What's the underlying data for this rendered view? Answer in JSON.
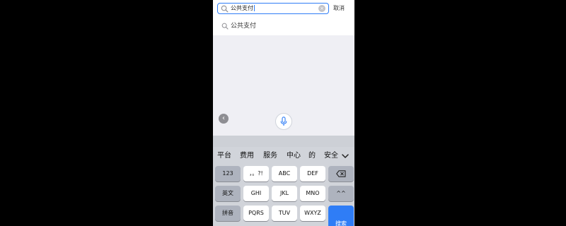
{
  "search": {
    "value": "公共支付",
    "cancel_label": "取消",
    "clear_glyph": "×"
  },
  "suggestions": [
    {
      "label": "公共支付"
    }
  ],
  "floating": {
    "back_glyph": "‹"
  },
  "keyboard": {
    "candidates": [
      "平台",
      "费用",
      "服务",
      "中心",
      "的",
      "安全"
    ],
    "rows": [
      [
        "123",
        "，。?!",
        "ABC",
        "DEF",
        ""
      ],
      [
        "英文",
        "GHI",
        "JKL",
        "MNO",
        "^^"
      ],
      [
        "拼音",
        "PQRS",
        "TUV",
        "WXYZ",
        "搜索"
      ]
    ]
  },
  "colors": {
    "accent": "#2f7df6",
    "keyboard_bg": "#d1d4da",
    "page_bg": "#efeff4"
  },
  "icons": [
    "search-icon",
    "clear-icon",
    "back-icon",
    "microphone-icon",
    "chevron-down-icon",
    "delete-icon"
  ]
}
